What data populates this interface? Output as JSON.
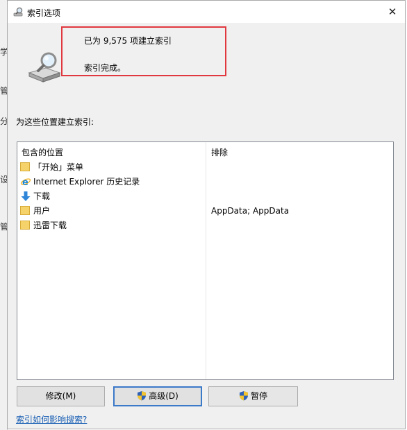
{
  "window": {
    "title": "索引选项",
    "close_glyph": "✕"
  },
  "background_chars": [
    "学",
    "管",
    "分",
    "设",
    "管"
  ],
  "status": {
    "line1": "已为 9,575 项建立索引",
    "line2": "索引完成。"
  },
  "section_label": "为这些位置建立索引:",
  "table": {
    "headers": {
      "included": "包含的位置",
      "excluded": "排除"
    },
    "rows": [
      {
        "icon": "folder-icon",
        "label": "「开始」菜单",
        "exclude": ""
      },
      {
        "icon": "internet-explorer-icon",
        "label": "Internet Explorer 历史记录",
        "exclude": ""
      },
      {
        "icon": "download-arrow-icon",
        "label": "下载",
        "exclude": ""
      },
      {
        "icon": "folder-icon",
        "label": "用户",
        "exclude": "AppData; AppData"
      },
      {
        "icon": "folder-icon",
        "label": "迅雷下载",
        "exclude": ""
      }
    ]
  },
  "buttons": {
    "modify": "修改(M)",
    "advanced": "高级(D)",
    "pause": "暂停"
  },
  "help_link": "索引如何影响搜索?",
  "colors": {
    "highlight_box": "#e0383e",
    "link": "#1a5fb4",
    "folder": "#f6d36a"
  }
}
